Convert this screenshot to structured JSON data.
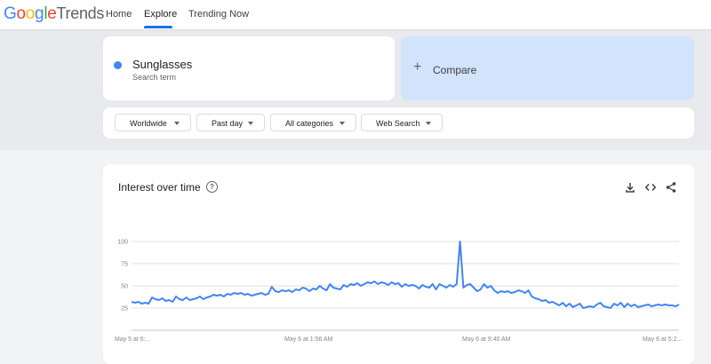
{
  "app": {
    "logo_text": "Google",
    "logo_product": "Trends",
    "nav": [
      {
        "label": "Home"
      },
      {
        "label": "Explore"
      },
      {
        "label": "Trending Now"
      }
    ],
    "active_nav": "Explore"
  },
  "search": {
    "term": "Sunglasses",
    "term_type": "Search term",
    "term_color": "#4285f4",
    "compare_label": "Compare",
    "compare_icon": "plus-icon"
  },
  "filters": [
    {
      "label": "Worldwide"
    },
    {
      "label": "Past day"
    },
    {
      "label": "All categories"
    },
    {
      "label": "Web Search"
    }
  ],
  "interest_card": {
    "title": "Interest over time",
    "help_icon": "help-icon",
    "actions": [
      "download-icon",
      "embed-icon",
      "share-icon"
    ]
  },
  "chart_data": {
    "type": "line",
    "title": "Interest over time",
    "ylim": [
      0,
      100
    ],
    "yticks": [
      "100",
      "75",
      "50",
      "25"
    ],
    "x_tick_labels": [
      "May 5 at 6:...",
      "May 6 at 1:56 AM",
      "May 6 at 9:40 AM",
      "May 6 at 5:2..."
    ],
    "grid": true,
    "series": [
      {
        "name": "Sunglasses",
        "color": "#4285f4",
        "values": [
          32,
          31,
          32,
          30,
          31,
          30,
          37,
          35,
          34,
          36,
          33,
          34,
          32,
          38,
          35,
          34,
          37,
          34,
          35,
          36,
          38,
          35,
          37,
          38,
          40,
          39,
          40,
          38,
          41,
          40,
          42,
          41,
          42,
          40,
          41,
          39,
          40,
          41,
          42,
          40,
          41,
          49,
          44,
          43,
          45,
          44,
          45,
          43,
          46,
          45,
          48,
          47,
          44,
          47,
          46,
          50,
          47,
          45,
          52,
          48,
          47,
          46,
          51,
          49,
          52,
          51,
          53,
          50,
          52,
          54,
          53,
          55,
          52,
          54,
          53,
          51,
          54,
          52,
          53,
          49,
          52,
          50,
          51,
          50,
          47,
          51,
          49,
          48,
          52,
          46,
          52,
          50,
          48,
          51,
          49,
          52,
          100,
          48,
          51,
          52,
          48,
          44,
          46,
          52,
          48,
          50,
          45,
          42,
          44,
          43,
          44,
          42,
          43,
          45,
          44,
          42,
          45,
          38,
          36,
          35,
          33,
          34,
          31,
          32,
          30,
          28,
          31,
          27,
          30,
          26,
          28,
          30,
          25,
          26,
          27,
          26,
          29,
          31,
          27,
          26,
          25,
          30,
          28,
          31,
          26,
          30,
          27,
          29,
          26,
          27,
          28,
          29,
          27,
          28,
          29,
          28,
          29,
          28,
          28,
          27,
          29
        ]
      }
    ]
  }
}
